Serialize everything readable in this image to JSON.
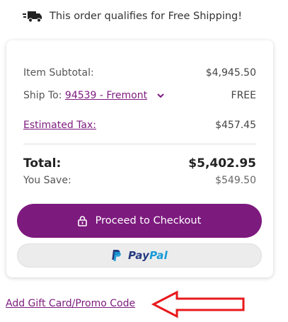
{
  "banner": {
    "icon": "truck-icon",
    "text": "This order qualifies for Free Shipping!"
  },
  "summary": {
    "subtotal_label": "Item Subtotal:",
    "subtotal_value": "$4,945.50",
    "ship_to_label": "Ship To:",
    "ship_to_location": "94539 - Fremont",
    "shipping_value": "FREE",
    "tax_label": "Estimated Tax:",
    "tax_value": "$457.45",
    "total_label": "Total:",
    "total_value": "$5,402.95",
    "save_label": "You Save:",
    "save_value": "$549.50"
  },
  "actions": {
    "checkout_label": "Proceed to Checkout",
    "paypal_pay": "Pay",
    "paypal_pal": "Pal"
  },
  "promo": {
    "link_label": "Add Gift Card/Promo Code"
  },
  "colors": {
    "accent": "#7d1a7e",
    "paypal_dark": "#253b80",
    "paypal_light": "#179bd7",
    "annotation_arrow": "#e8191c"
  }
}
